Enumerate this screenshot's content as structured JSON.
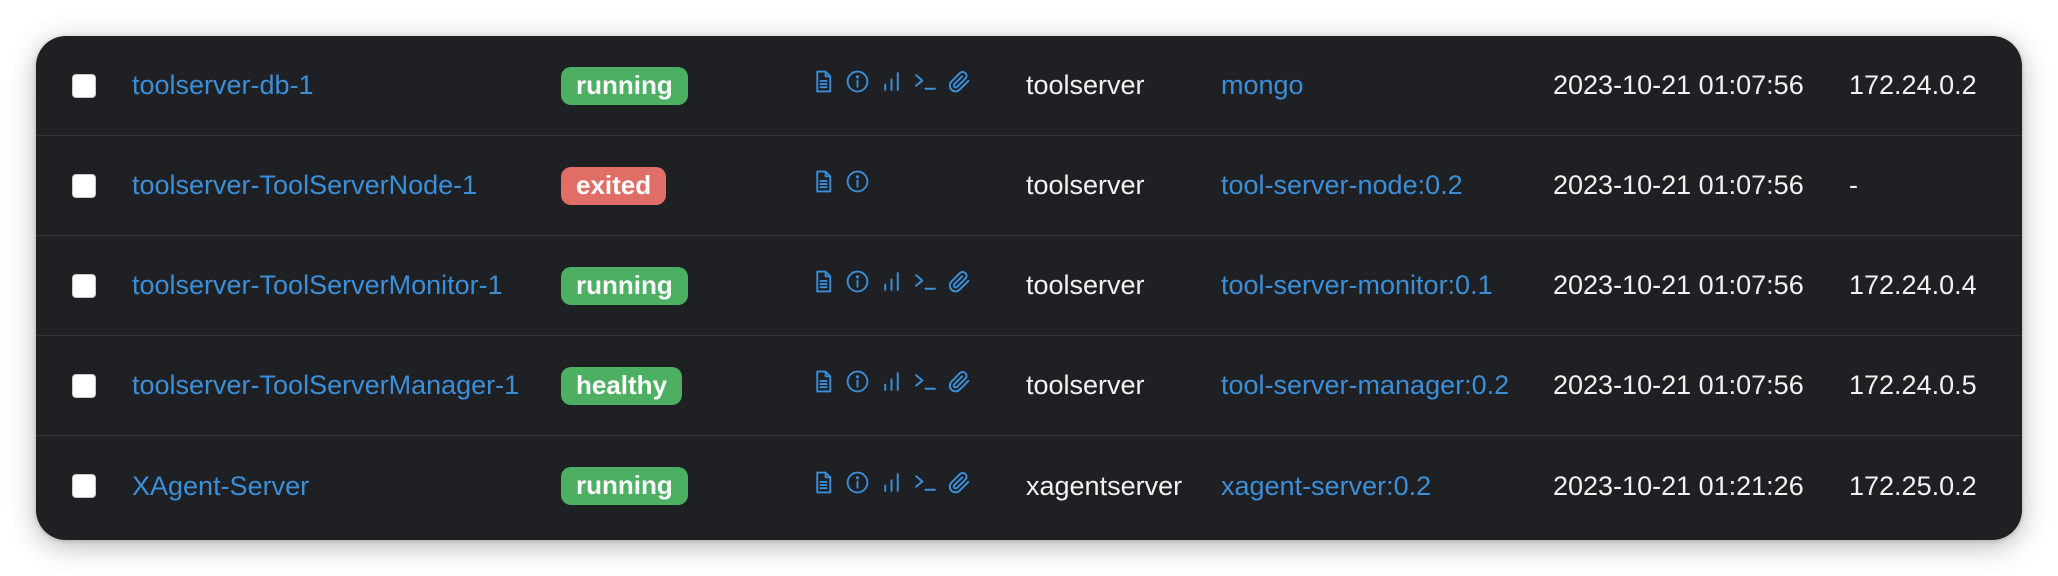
{
  "colors": {
    "panel": "#1f2023",
    "link": "#3b8fd9",
    "running": "#4caf61",
    "healthy": "#4caf61",
    "exited": "#e06e66"
  },
  "containers": [
    {
      "name": "toolserver-db-1",
      "state": "running",
      "actions": [
        "logs-icon",
        "inspect-icon",
        "stats-icon",
        "console-icon",
        "attach-icon"
      ],
      "stack": "toolserver",
      "image": "mongo",
      "created": "2023-10-21 01:07:56",
      "ip": "172.24.0.2"
    },
    {
      "name": "toolserver-ToolServerNode-1",
      "state": "exited",
      "actions": [
        "logs-icon",
        "inspect-icon"
      ],
      "stack": "toolserver",
      "image": "tool-server-node:0.2",
      "created": "2023-10-21 01:07:56",
      "ip": "-"
    },
    {
      "name": "toolserver-ToolServerMonitor-1",
      "state": "running",
      "actions": [
        "logs-icon",
        "inspect-icon",
        "stats-icon",
        "console-icon",
        "attach-icon"
      ],
      "stack": "toolserver",
      "image": "tool-server-monitor:0.1",
      "created": "2023-10-21 01:07:56",
      "ip": "172.24.0.4"
    },
    {
      "name": "toolserver-ToolServerManager-1",
      "state": "healthy",
      "actions": [
        "logs-icon",
        "inspect-icon",
        "stats-icon",
        "console-icon",
        "attach-icon"
      ],
      "stack": "toolserver",
      "image": "tool-server-manager:0.2",
      "created": "2023-10-21 01:07:56",
      "ip": "172.24.0.5"
    },
    {
      "name": "XAgent-Server",
      "state": "running",
      "actions": [
        "logs-icon",
        "inspect-icon",
        "stats-icon",
        "console-icon",
        "attach-icon"
      ],
      "stack": "xagentserver",
      "image": "xagent-server:0.2",
      "created": "2023-10-21 01:21:26",
      "ip": "172.25.0.2"
    }
  ]
}
